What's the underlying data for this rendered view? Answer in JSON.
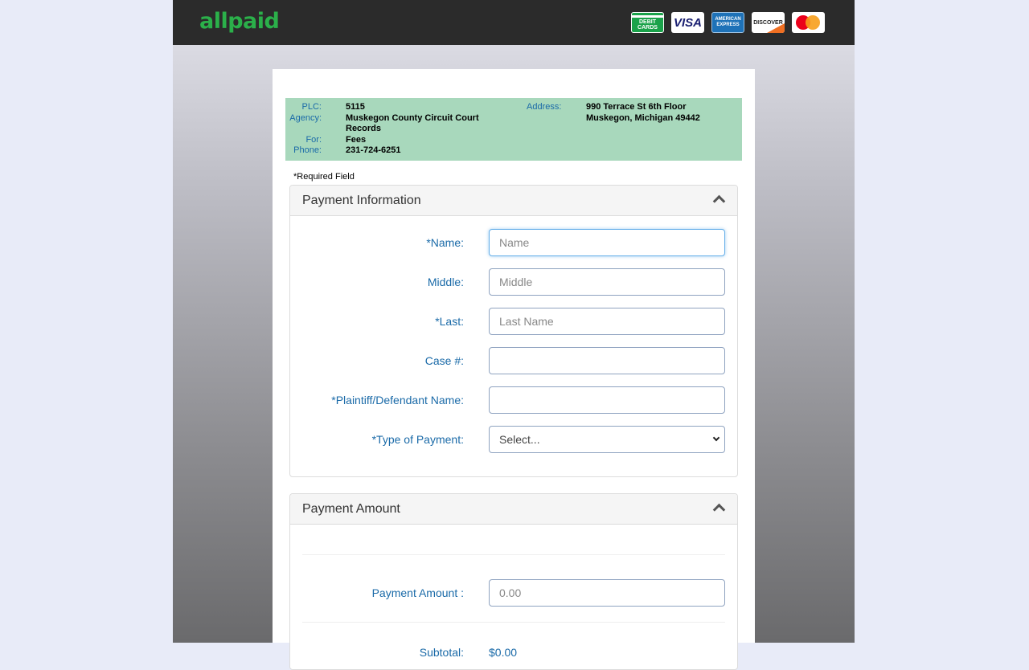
{
  "header": {
    "logo": "allpaid",
    "cards": [
      {
        "name": "debit-card-icon",
        "text_top": "DEBIT",
        "text_bottom": "CARDS"
      },
      {
        "name": "visa-icon",
        "text": "VISA"
      },
      {
        "name": "amex-icon",
        "text_top": "AMERICAN",
        "text_bottom": "EXPRESS"
      },
      {
        "name": "discover-icon",
        "text": "DISCOVER"
      },
      {
        "name": "mastercard-icon"
      }
    ]
  },
  "agency": {
    "plc_label": "PLC:",
    "plc_value": "5115",
    "agency_label": "Agency:",
    "agency_value_line1": "Muskegon County Circuit Court",
    "agency_value_line2": "Records",
    "for_label": "For:",
    "for_value": "Fees",
    "phone_label": "Phone:",
    "phone_value": "231-724-6251",
    "address_label": "Address:",
    "address_line1": "990 Terrace St 6th Floor",
    "address_line2": "Muskegon, Michigan 49442"
  },
  "required_note": "*Required Field",
  "payment_info": {
    "title": "Payment Information",
    "fields": {
      "name": {
        "label": "*Name:",
        "placeholder": "Name",
        "value": ""
      },
      "middle": {
        "label": "Middle:",
        "placeholder": "Middle",
        "value": ""
      },
      "last": {
        "label": "*Last:",
        "placeholder": "Last Name",
        "value": ""
      },
      "case": {
        "label": "Case #:",
        "placeholder": "",
        "value": ""
      },
      "plaintiff": {
        "label": "*Plaintiff/Defendant Name:",
        "placeholder": "",
        "value": ""
      },
      "type": {
        "label": "*Type of Payment:",
        "selected": "Select..."
      }
    }
  },
  "payment_amount": {
    "title": "Payment Amount",
    "amount_label": "Payment Amount :",
    "amount_placeholder": "0.00",
    "subtotal_label": "Subtotal:",
    "subtotal_value": "$0.00"
  },
  "colors": {
    "brand_green": "#2bb04a",
    "agency_bg": "#a8d8bc",
    "label_blue": "#1a6aa8",
    "topbar": "#2b2b2b"
  }
}
